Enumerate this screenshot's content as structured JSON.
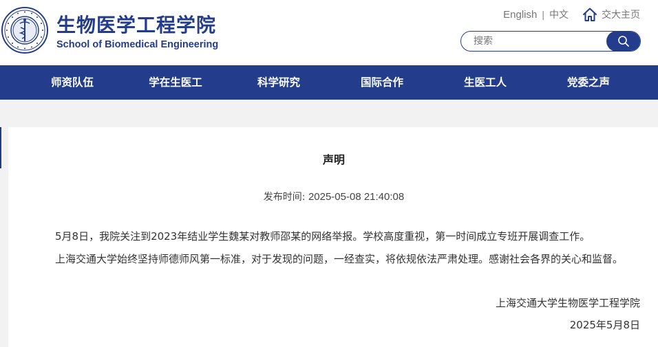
{
  "header": {
    "title_cn": "生物医学工程学院",
    "title_en": "School of Biomedical Engineering",
    "lang_en": "English",
    "lang_sep": "|",
    "lang_cn": "中文",
    "home_label": "交大主页"
  },
  "search": {
    "placeholder": "搜索",
    "value": ""
  },
  "nav": {
    "items": [
      {
        "label": "师资队伍"
      },
      {
        "label": "学在生医工"
      },
      {
        "label": "科学研究"
      },
      {
        "label": "国际合作"
      },
      {
        "label": "生医工人"
      },
      {
        "label": "党委之声"
      }
    ]
  },
  "article": {
    "title": "声明",
    "published_label": "发布时间:",
    "published_date": "2025-05-08 21:40:08",
    "paragraphs": [
      "5月8日，我院关注到2023年结业学生魏某对教师邵某的网络举报。学校高度重视，第一时间成立专班开展调查工作。",
      "上海交通大学始终坚持师德师风第一标准，对于发现的问题，一经查实，将依规依法严肃处理。感谢社会各界的关心和监督。"
    ],
    "signature": "上海交通大学生物医学工程学院",
    "sign_date": "2025年5月8日"
  },
  "colors": {
    "brand": "#233d8c",
    "page_bg": "#f2f2f2"
  },
  "icons": {
    "logo": "university-seal-logo",
    "home": "home-icon",
    "search": "search-icon"
  }
}
